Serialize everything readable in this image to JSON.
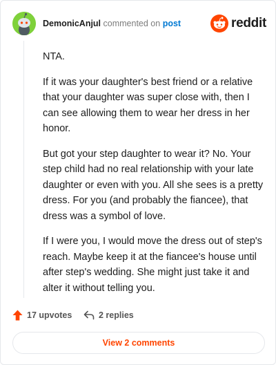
{
  "comment": {
    "username": "DemonicAnjul",
    "action_text": "commented on",
    "post_link_text": "post",
    "paragraphs": [
      "NTA.",
      "If it was your daughter's best friend or a relative that your daughter was super close with, then I can see allowing them to wear her dress in her honor.",
      "But got your step daughter to wear it? No. Your step child had no real relationship with your late daughter or even with you. All she sees is a pretty dress. For you (and probably the fiancee), that dress was a symbol of love.",
      "If I were you, I would move the dress out of step's reach. Maybe keep it at the fiancee's house until after step's wedding. She might just take it and alter it without telling you."
    ],
    "upvotes_label": "17 upvotes",
    "replies_label": "2 replies",
    "view_comments_label": "View 2 comments"
  },
  "brand": {
    "wordmark": "reddit",
    "logo_icon": "reddit-snoo-icon",
    "accent_color": "#ff4500"
  },
  "icons": {
    "avatar": "snoo-avatar-icon",
    "upvote": "upvote-arrow-icon",
    "reply": "reply-arrow-icon"
  },
  "colors": {
    "avatar_bg": "#7fd13b",
    "link": "#0079d3",
    "upvote": "#ff4500"
  }
}
